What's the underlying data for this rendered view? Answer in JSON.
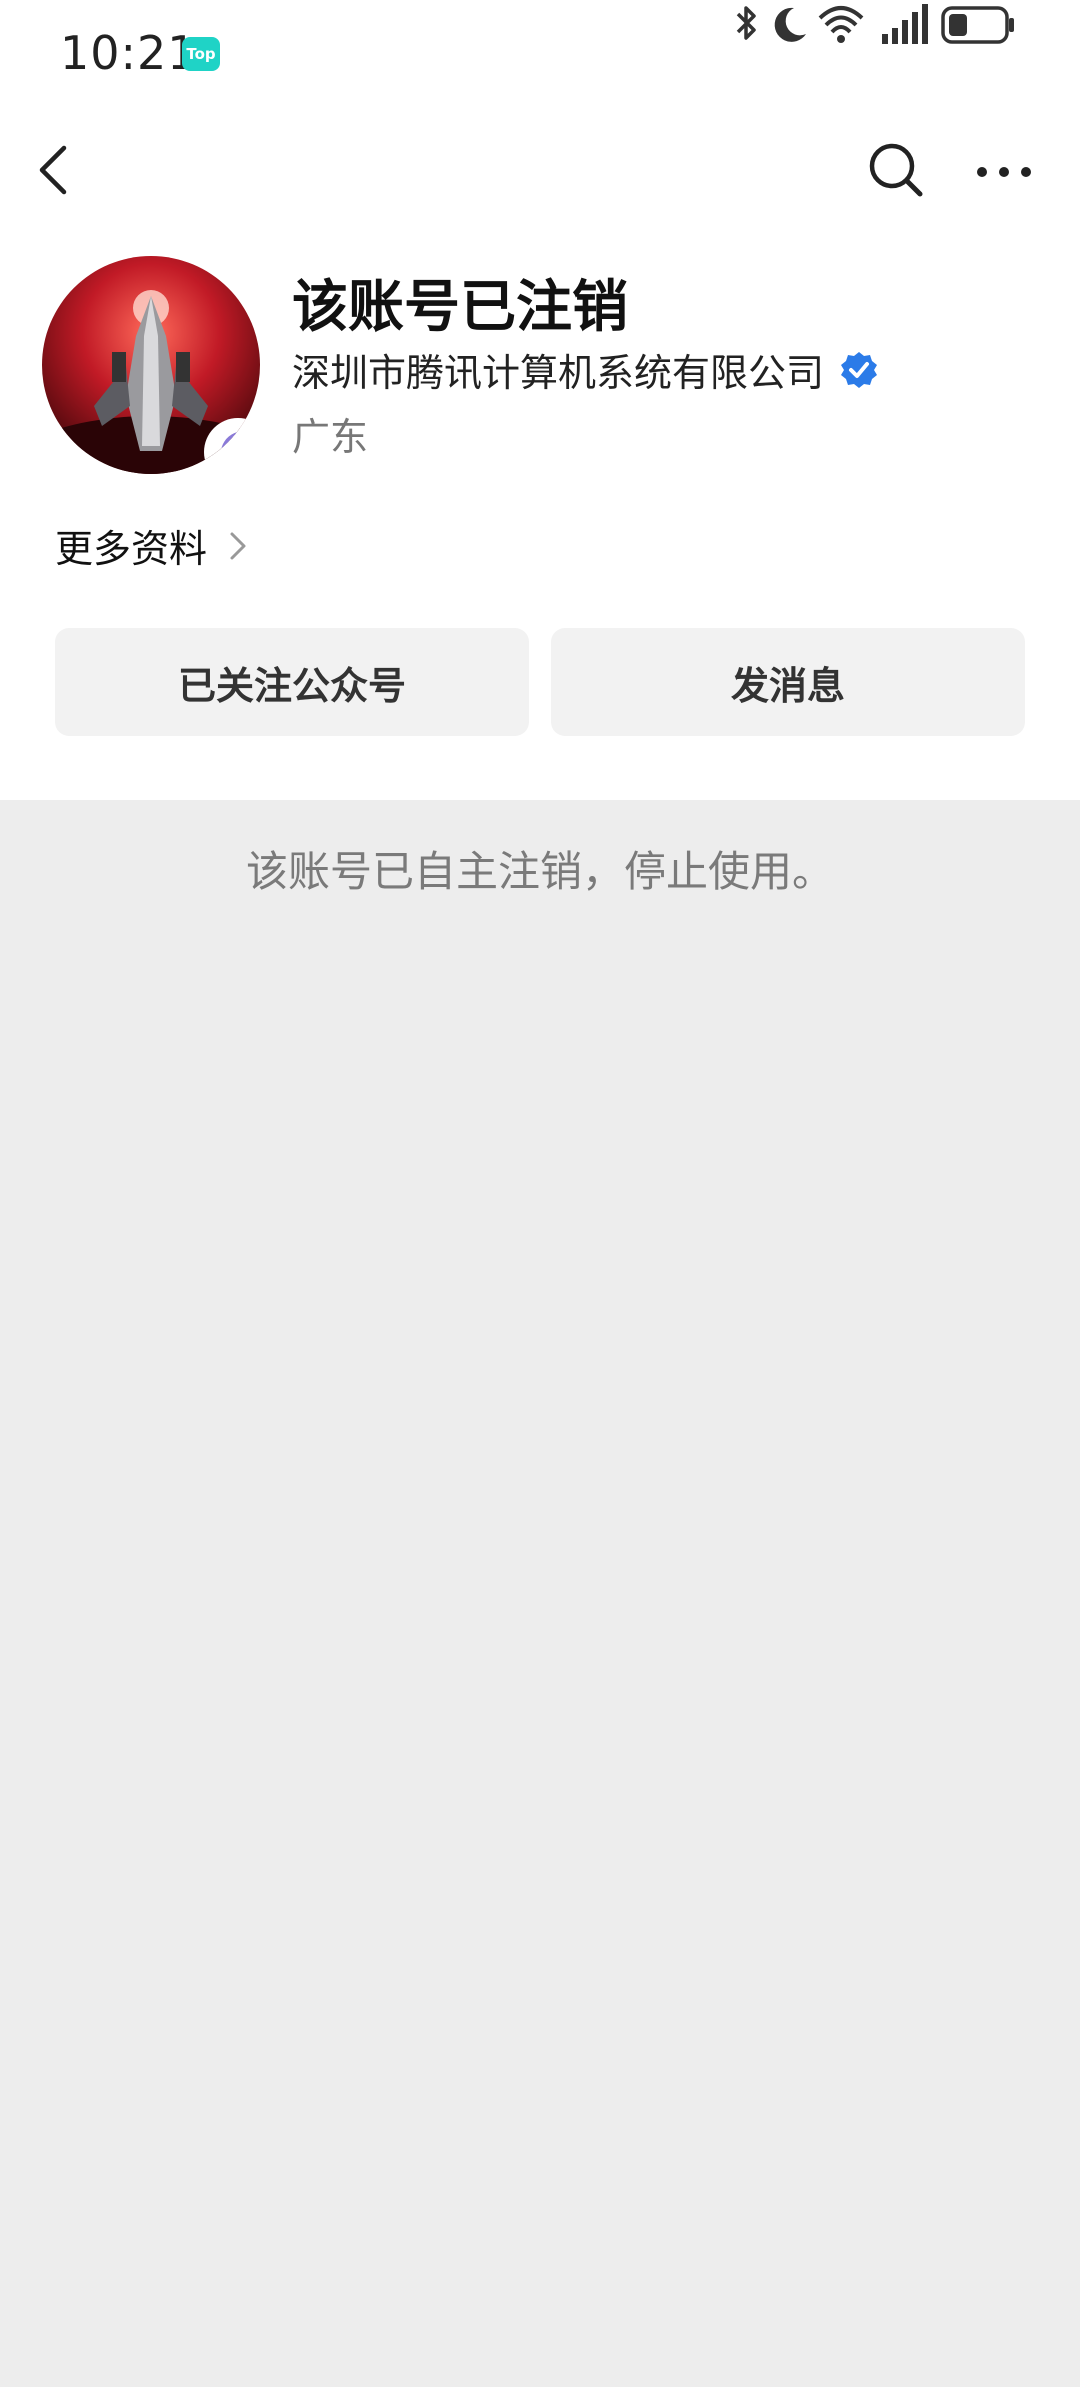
{
  "status_bar": {
    "time": "10:21",
    "badge": "Top",
    "icons": [
      "bluetooth-icon",
      "moon-icon",
      "wifi-icon",
      "signal-icon",
      "battery-icon"
    ]
  },
  "nav": {
    "back_icon": "chevron-left-icon",
    "search_icon": "search-icon",
    "more_icon": "more-dots-icon"
  },
  "profile": {
    "account_name": "该账号已注销",
    "company": "深圳市腾讯计算机系统有限公司",
    "region": "广东",
    "more_info": "更多资料"
  },
  "actions": {
    "follow_label": "已关注公众号",
    "message_label": "发消息"
  },
  "notice": "该账号已自主注销，停止使用。",
  "colors": {
    "background": "#ededed",
    "card": "#ffffff",
    "button_bg": "#f2f2f2",
    "verified_blue": "#2b7be8",
    "badge_teal": "#1fd3c6"
  }
}
